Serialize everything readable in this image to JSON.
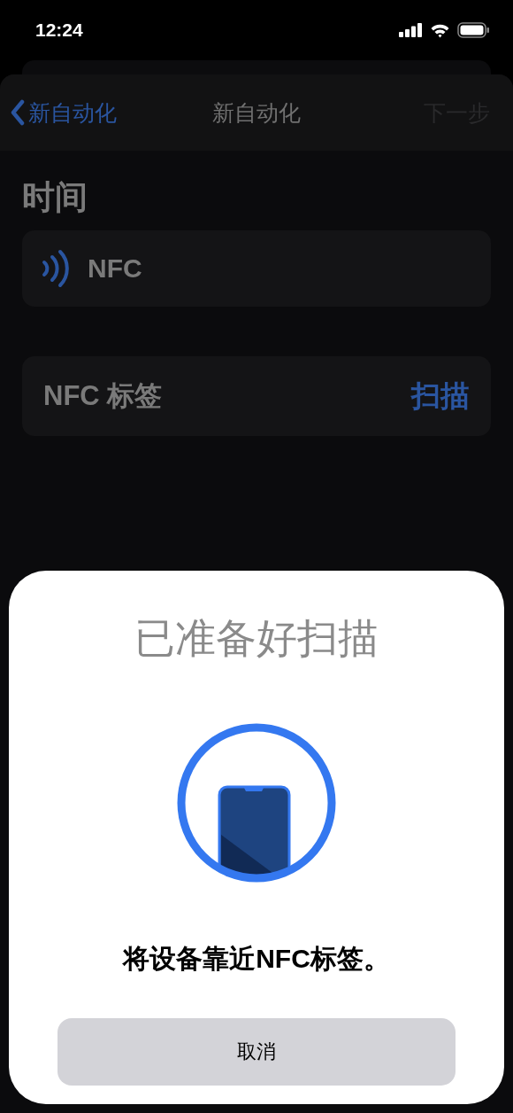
{
  "status_bar": {
    "time": "12:24"
  },
  "nav": {
    "back": "新自动化",
    "title": "新自动化",
    "next": "下一步",
    "next_disabled": true
  },
  "section_title": "时间",
  "trigger": {
    "label": "NFC"
  },
  "tag_row": {
    "label": "NFC 标签",
    "action": "扫描"
  },
  "scan_sheet": {
    "title": "已准备好扫描",
    "message": "将设备靠近NFC标签。",
    "cancel": "取消"
  }
}
